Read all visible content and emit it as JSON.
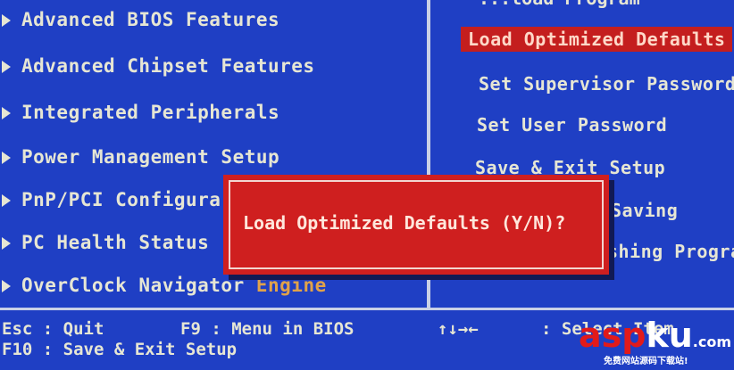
{
  "left_menu": {
    "items": [
      {
        "label": "Advanced BIOS Features"
      },
      {
        "label": "Advanced Chipset Features"
      },
      {
        "label": "Integrated Peripherals"
      },
      {
        "label": "Power Management Setup"
      },
      {
        "label": "PnP/PCI Configura"
      },
      {
        "label": "PC Health Status"
      },
      {
        "label": "OverClock Navigator"
      }
    ],
    "overclock_suffix": "Engine"
  },
  "right_menu": {
    "partial_top": "...load Program",
    "items": [
      {
        "label": "Load Optimized Defaults",
        "selected": true
      },
      {
        "label": "Set Supervisor Password"
      },
      {
        "label": "Set User Password"
      },
      {
        "label": "Save & Exit Setup"
      },
      {
        "label": "Saving"
      },
      {
        "label": "shing Program"
      }
    ]
  },
  "dialog": {
    "prompt": "Load Optimized Defaults (Y/N)?"
  },
  "footer": {
    "line1_left": "Esc : Quit",
    "line1_mid": "F9 : Menu in BIOS",
    "line1_arrows": "↑↓→←",
    "line1_right": ": Select Item",
    "line2_left": "F10 : Save & Exit Setup"
  },
  "watermark": {
    "asp": "asp",
    "ku": "ku",
    "com": ".com",
    "sub": "免费网站源码下载站!"
  },
  "colors": {
    "background": "#1f3fc4",
    "text": "#e6e6d4",
    "highlight": "#c41e1e",
    "dialog": "#cf1f1f"
  }
}
